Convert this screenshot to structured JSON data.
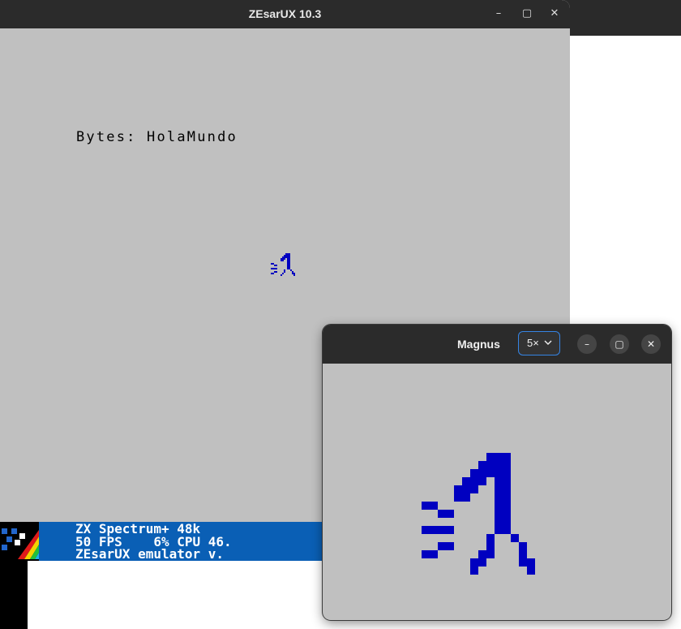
{
  "zesarux": {
    "title": "ZEsarUX 10.3",
    "controls": {
      "minimize": "–",
      "maximize": "▢",
      "close": "✕"
    },
    "screen_text": "Bytes: HolaMundo",
    "footer_lines": [
      "ZX Spectrum+ 48k",
      "50 FPS    6% CPU 46.",
      "ZEsarUX emulator v."
    ],
    "colors": {
      "screen_bg": "#c0c0c0",
      "ink": "#0000c0",
      "footer_bg": "#0a5fb5"
    }
  },
  "magnus": {
    "title": "Magnus",
    "zoom": "5×",
    "controls": {
      "minimize": "–",
      "maximize": "▢",
      "close": "✕"
    },
    "accent": "#3584e4"
  }
}
